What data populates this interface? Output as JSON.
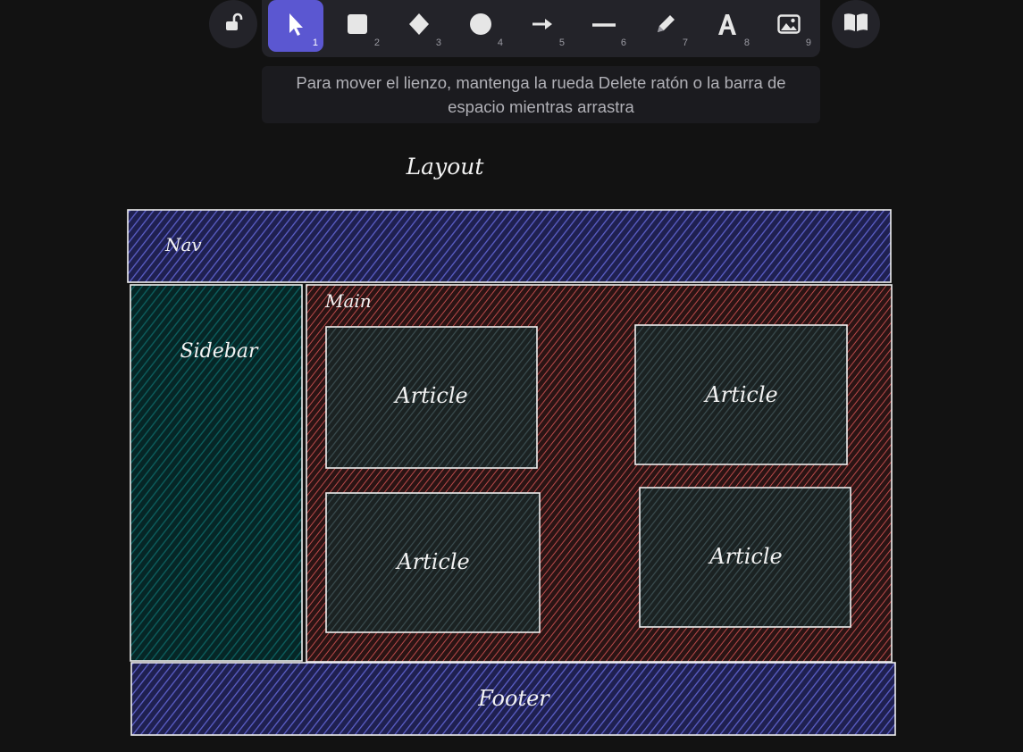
{
  "toolbar": {
    "lock": {
      "icon": "unlock-icon"
    },
    "library": {
      "icon": "book-icon"
    },
    "tools": [
      {
        "name": "selection",
        "icon": "pointer-icon",
        "key": "1",
        "active": true
      },
      {
        "name": "rectangle",
        "icon": "square-icon",
        "key": "2"
      },
      {
        "name": "diamond",
        "icon": "diamond-icon",
        "key": "3"
      },
      {
        "name": "ellipse",
        "icon": "circle-icon",
        "key": "4"
      },
      {
        "name": "arrow",
        "icon": "arrow-right-icon",
        "key": "5"
      },
      {
        "name": "line",
        "icon": "line-icon",
        "key": "6"
      },
      {
        "name": "draw",
        "icon": "pencil-icon",
        "key": "7"
      },
      {
        "name": "text",
        "icon": "text-icon",
        "key": "8"
      },
      {
        "name": "image",
        "icon": "image-icon",
        "key": "9"
      }
    ],
    "accent": "#5b57d1"
  },
  "hint": {
    "text": "Para mover el lienzo, mantenga la rueda Delete ratón o la barra de espacio mientras arrastra"
  },
  "canvas": {
    "title": "Layout",
    "nav": {
      "label": "Nav",
      "color": "#5b5fc7"
    },
    "sidebar": {
      "label": "Sidebar",
      "color": "#0c5d5d"
    },
    "main": {
      "label": "Main",
      "color": "#b94a4a"
    },
    "articles": [
      {
        "label": "Article"
      },
      {
        "label": "Article"
      },
      {
        "label": "Article"
      },
      {
        "label": "Article"
      }
    ],
    "footer": {
      "label": "Footer",
      "color": "#5b5fc7"
    }
  }
}
